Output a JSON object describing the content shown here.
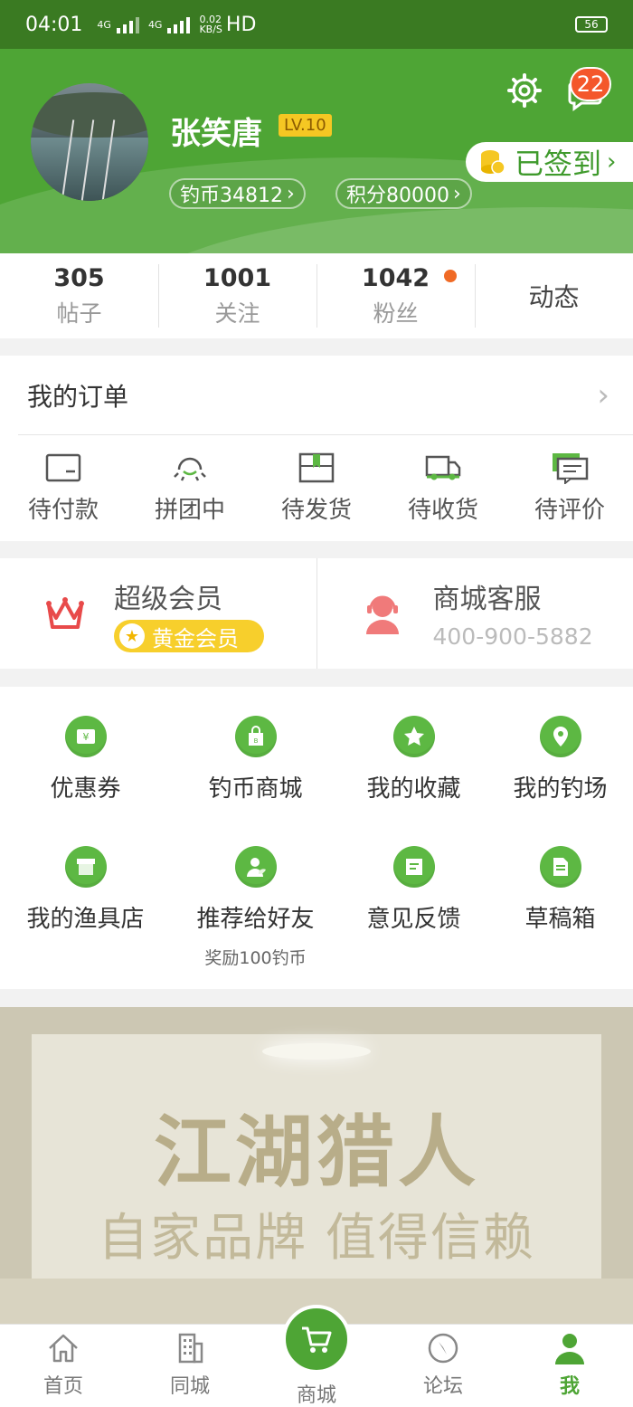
{
  "status_bar": {
    "time": "04:01",
    "net1": "4G",
    "net2": "4G",
    "speed_value": "0.02",
    "speed_unit": "KB/S",
    "hd": "HD",
    "battery": "56"
  },
  "profile": {
    "username": "张笑唐",
    "level": "LV.10",
    "coins": "钓币34812",
    "points": "积分80000",
    "message_count": "22",
    "signin_label": "已签到",
    "theme_color": "#4ea535"
  },
  "stats": [
    {
      "value": "305",
      "label": "帖子"
    },
    {
      "value": "1001",
      "label": "关注"
    },
    {
      "value": "1042",
      "label": "粉丝"
    },
    {
      "label": "动态"
    }
  ],
  "orders": {
    "title": "我的订单",
    "items": [
      {
        "label": "待付款",
        "icon": "wallet-icon"
      },
      {
        "label": "拼团中",
        "icon": "group-icon"
      },
      {
        "label": "待发货",
        "icon": "package-icon"
      },
      {
        "label": "待收货",
        "icon": "truck-icon"
      },
      {
        "label": "待评价",
        "icon": "comment-icon"
      }
    ]
  },
  "vip": {
    "title": "超级会员",
    "tier": "黄金会员",
    "service_title": "商城客服",
    "service_phone": "400-900-5882"
  },
  "grid": [
    {
      "label": "优惠券",
      "icon": "coupon-icon"
    },
    {
      "label": "钓币商城",
      "icon": "shopping-bag-icon"
    },
    {
      "label": "我的收藏",
      "icon": "star-icon"
    },
    {
      "label": "我的钓场",
      "icon": "location-icon"
    },
    {
      "label": "我的渔具店",
      "icon": "store-icon"
    },
    {
      "label": "推荐给好友",
      "icon": "share-user-icon",
      "sub": "奖励100钓币"
    },
    {
      "label": "意见反馈",
      "icon": "feedback-icon"
    },
    {
      "label": "草稿箱",
      "icon": "draft-icon"
    }
  ],
  "banner": {
    "title": "江湖猎人",
    "subtitle": "自家品牌 值得信赖"
  },
  "tabs": [
    {
      "label": "首页",
      "icon": "home-icon"
    },
    {
      "label": "同城",
      "icon": "building-icon"
    },
    {
      "label": "商城",
      "icon": "cart-icon"
    },
    {
      "label": "论坛",
      "icon": "compass-icon"
    },
    {
      "label": "我",
      "icon": "user-icon"
    }
  ]
}
